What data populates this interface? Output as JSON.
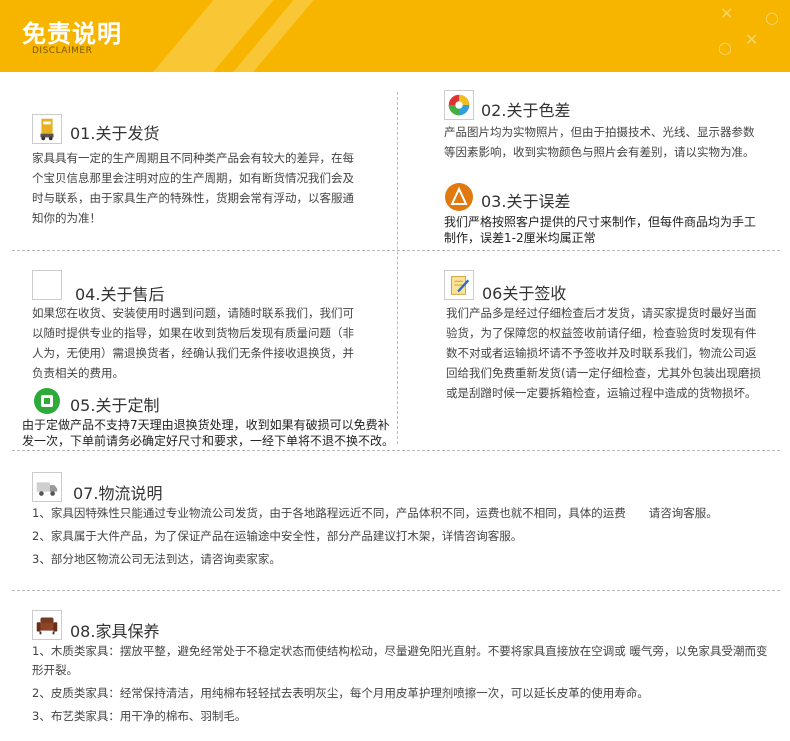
{
  "header": {
    "title": "免责说明",
    "subtitle": "DISCLAIMER"
  },
  "sections": {
    "s01": {
      "title": "01.关于发货",
      "text": "家具具有一定的生产周期且不同种类产品会有较大的差异，在每个宝贝信息那里会注明对应的生产周期，如有断货情况我们会及时与联系，由于家具生产的特殊性，货期会常有浮动，以客服通知你的为准！"
    },
    "s02": {
      "title": "02.关于色差",
      "text": "产品图片均为实物照片，但由于拍摄技术、光线、显示器参数等因素影响，收到实物颜色与照片会有差别，请以实物为准。"
    },
    "s03": {
      "title": "03.关于误差",
      "text": "我们严格按照客户提供的尺寸来制作，但每件商品均为手工制作，误差1-2厘米均属正常"
    },
    "s04": {
      "title": "04.关于售后",
      "text": "如果您在收货、安装使用时遇到问题，请随时联系我们，我们可以随时提供专业的指导，如果在收到货物后发现有质量问题（非人为，无使用）需退换货者，经确认我们无条件接收退换货，并负责相关的费用。"
    },
    "s05": {
      "title": "05.关于定制",
      "text": "由于定做产品不支持7天理由退换货处理，收到如果有破损可以免费补发一次，下单前请务必确定好尺寸和要求，一经下单将不退不换不改。"
    },
    "s06": {
      "title": "06关于签收",
      "text": "我们产品多是经过仔细检查后才发货，请买家提货时最好当面验货，为了保障您的权益签收前请仔细，检查验货时发现有件数不对或者运输损坏请不予签收并及时联系我们，物流公司返回给我们免费重新发货(请一定仔细检查，尤其外包装出现磨损或是刮蹭时候一定要拆箱检查，运输过程中造成的货物损坏。"
    },
    "s07": {
      "title": "07.物流说明",
      "items": [
        "1、家具因特殊性只能通过专业物流公司发货，由于各地路程远近不同，产品体积不同，运费也就不相同，具体的运费　　请咨询客服。",
        "2、家具属于大件产品，为了保证产品在运输途中安全性，部分产品建议打木架，详情咨询客服。",
        "3、部分地区物流公司无法到达，请咨询卖家家。"
      ]
    },
    "s08": {
      "title": "08.家具保养",
      "items": [
        "1、木质类家具：摆放平整，避免经常处于不稳定状态而使结构松动，尽量避免阳光直射。不要将家具直接放在空调或 暖气旁，以免家具受潮而变形开裂。",
        "2、皮质类家具：经常保持清洁，用纯棉布轻轻拭去表明灰尘，每个月用皮革护理剂喷擦一次，可以延长皮革的使用寿命。",
        "3、布艺类家具：用干净的棉布、羽制毛。"
      ]
    }
  },
  "colors": {
    "banner": "#f7b500",
    "accent": "#ffffff"
  },
  "icons": [
    "cargo-icon",
    "color-wheel-icon",
    "ruler-icon",
    "blank-icon",
    "recycle-icon",
    "sign-icon",
    "truck-icon",
    "sofa-icon"
  ]
}
